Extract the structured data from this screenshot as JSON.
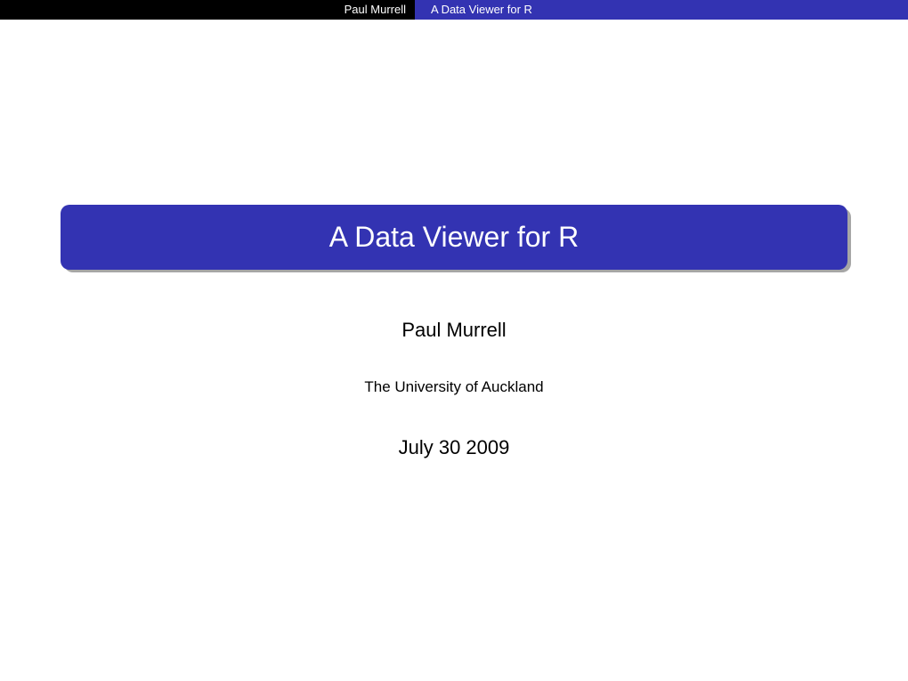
{
  "header": {
    "author": "Paul Murrell",
    "title": "A Data Viewer for R"
  },
  "slide": {
    "title": "A Data Viewer for R",
    "author": "Paul Murrell",
    "institution": "The University of Auckland",
    "date": "July 30 2009"
  }
}
